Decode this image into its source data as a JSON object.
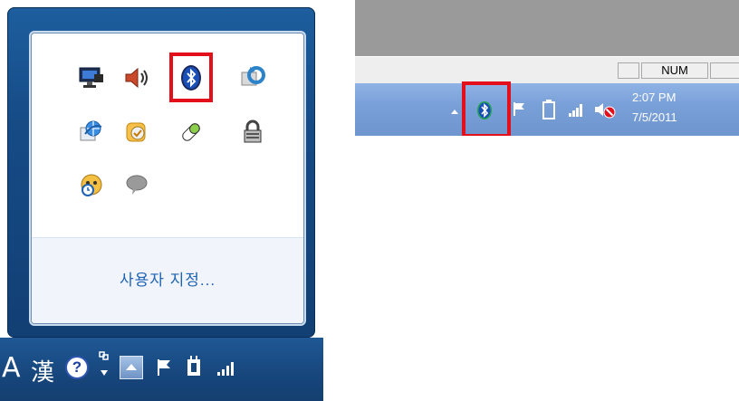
{
  "flyout": {
    "icons": [
      "network-icon",
      "volume-icon",
      "bluetooth-icon",
      "sync-icon",
      "internet-globe-icon",
      "messenger-icon",
      "pill-icon",
      "lock-icon",
      "clock-face-icon",
      "speech-bubble-icon"
    ],
    "customize_label": "사용자 지정..."
  },
  "left_taskbar": {
    "lang_label": "A",
    "ime_label": "漢",
    "help_label": "?"
  },
  "status_bar": {
    "num_label": "NUM"
  },
  "clock": {
    "time": "2:07 PM",
    "date": "7/5/2011"
  },
  "colors": {
    "highlight": "#e3101b",
    "bluetooth_blue": "#1a4fb8",
    "bluetooth_green": "#1fa64a",
    "link_blue": "#1d62b3",
    "taskbar_dark": "#17467c",
    "taskbar_light": "#7aa0d8"
  }
}
